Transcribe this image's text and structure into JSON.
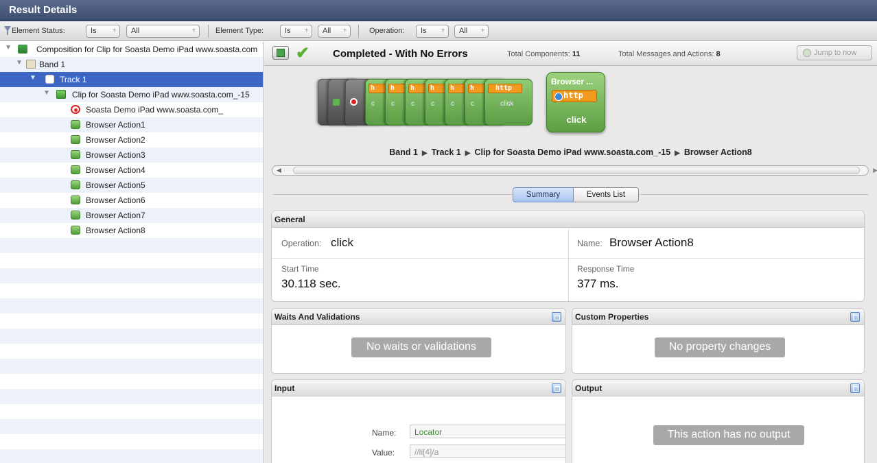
{
  "window": {
    "title": "Result Details"
  },
  "filters": {
    "element_status_label": "Element Status:",
    "element_status_op": "Is",
    "element_status_value": "All",
    "element_type_label": "Element Type:",
    "element_type_op": "Is",
    "element_type_value": "All",
    "operation_label": "Operation:",
    "operation_op": "Is",
    "operation_value": "All",
    "arrow": "÷"
  },
  "tree": {
    "composition": "Composition for Clip for Soasta Demo iPad www.soasta.com",
    "band": "Band 1",
    "track": "Track 1",
    "clip": "Clip for Soasta Demo iPad www.soasta.com_-15",
    "page": "Soasta Demo iPad www.soasta.com_",
    "actions": [
      "Browser Action1",
      "Browser Action2",
      "Browser Action3",
      "Browser Action4",
      "Browser Action5",
      "Browser Action6",
      "Browser Action7",
      "Browser Action8"
    ]
  },
  "status": {
    "text": "Completed - With No Errors",
    "total_components_label": "Total Components:",
    "total_components": "11",
    "total_messages_label": "Total Messages and Actions:",
    "total_messages": "8",
    "jump_label": "Jump to now"
  },
  "timeline": {
    "card_title": "Browser ...",
    "card_http": "http",
    "card_action": "click",
    "stack_http": "http",
    "stack_action": "click",
    "stack_h": "h",
    "stack_c": "c"
  },
  "breadcrumb": [
    "Band 1",
    "Track 1",
    "Clip for Soasta Demo iPad www.soasta.com_-15",
    "Browser Action8"
  ],
  "breadcrumb_sep": "▶",
  "tabs": {
    "summary": "Summary",
    "events": "Events List"
  },
  "general": {
    "title": "General",
    "operation_label": "Operation:",
    "operation_value": "click",
    "name_label": "Name:",
    "name_value": "Browser Action8",
    "start_label": "Start Time",
    "start_value": "30.118 sec.",
    "response_label": "Response Time",
    "response_value": "377 ms."
  },
  "waits": {
    "title": "Waits And Validations",
    "empty": "No waits or validations"
  },
  "custom": {
    "title": "Custom Properties",
    "empty": "No property changes"
  },
  "input": {
    "title": "Input",
    "name_label": "Name:",
    "name_value": "Locator",
    "value_label": "Value:",
    "value_value": "//li[4]/a"
  },
  "output": {
    "title": "Output",
    "empty": "This action has no output"
  },
  "icons": [
    "funnel-icon",
    "expand-triangle-icon",
    "composition-icon",
    "band-icon",
    "track-icon",
    "clip-icon",
    "page-icon",
    "browser-action-icon",
    "exit-icon",
    "check-icon",
    "jump-icon",
    "popout-icon"
  ],
  "colors": {
    "title_bar": "#3d4d70",
    "selection": "#3d66c4",
    "success": "#5bb033",
    "http_badge": "#f29a1f",
    "card_green": "#5c9f43"
  }
}
